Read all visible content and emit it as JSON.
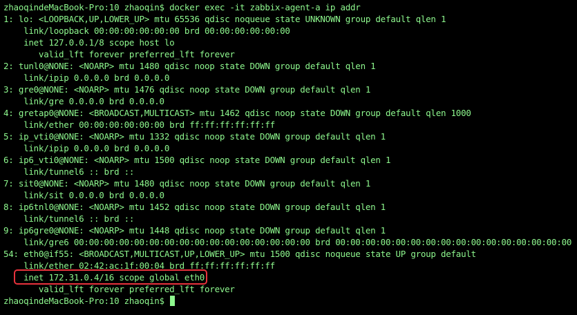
{
  "terminal": {
    "text_color": "#8ef88e",
    "background": "#000000",
    "highlight_color": "#e8323c",
    "lines": [
      "zhaoqindeMacBook-Pro:10 zhaoqin$ docker exec -it zabbix-agent-a ip addr",
      "1: lo: <LOOPBACK,UP,LOWER_UP> mtu 65536 qdisc noqueue state UNKNOWN group default qlen 1",
      "    link/loopback 00:00:00:00:00:00 brd 00:00:00:00:00:00",
      "    inet 127.0.0.1/8 scope host lo",
      "       valid_lft forever preferred_lft forever",
      "2: tunl0@NONE: <NOARP> mtu 1480 qdisc noop state DOWN group default qlen 1",
      "    link/ipip 0.0.0.0 brd 0.0.0.0",
      "3: gre0@NONE: <NOARP> mtu 1476 qdisc noop state DOWN group default qlen 1",
      "    link/gre 0.0.0.0 brd 0.0.0.0",
      "4: gretap0@NONE: <BROADCAST,MULTICAST> mtu 1462 qdisc noop state DOWN group default qlen 1000",
      "    link/ether 00:00:00:00:00:00 brd ff:ff:ff:ff:ff:ff",
      "5: ip_vti0@NONE: <NOARP> mtu 1332 qdisc noop state DOWN group default qlen 1",
      "    link/ipip 0.0.0.0 brd 0.0.0.0",
      "6: ip6_vti0@NONE: <NOARP> mtu 1500 qdisc noop state DOWN group default qlen 1",
      "    link/tunnel6 :: brd ::",
      "7: sit0@NONE: <NOARP> mtu 1480 qdisc noop state DOWN group default qlen 1",
      "    link/sit 0.0.0.0 brd 0.0.0.0",
      "8: ip6tnl0@NONE: <NOARP> mtu 1452 qdisc noop state DOWN group default qlen 1",
      "    link/tunnel6 :: brd ::",
      "9: ip6gre0@NONE: <NOARP> mtu 1448 qdisc noop state DOWN group default qlen 1",
      "    link/gre6 00:00:00:00:00:00:00:00:00:00:00:00:00:00:00:00 brd 00:00:00:00:00:00:00:00:00:00:00:00:00:00:00:00",
      "54: eth0@if55: <BROADCAST,MULTICAST,UP,LOWER_UP> mtu 1500 qdisc noqueue state UP group default",
      "    link/ether 02:42:ac:1f:00:04 brd ff:ff:ff:ff:ff:ff",
      "    inet 172.31.0.4/16 scope global eth0",
      "       valid_lft forever preferred_lft forever"
    ],
    "prompt": "zhaoqindeMacBook-Pro:10 zhaoqin$ "
  }
}
